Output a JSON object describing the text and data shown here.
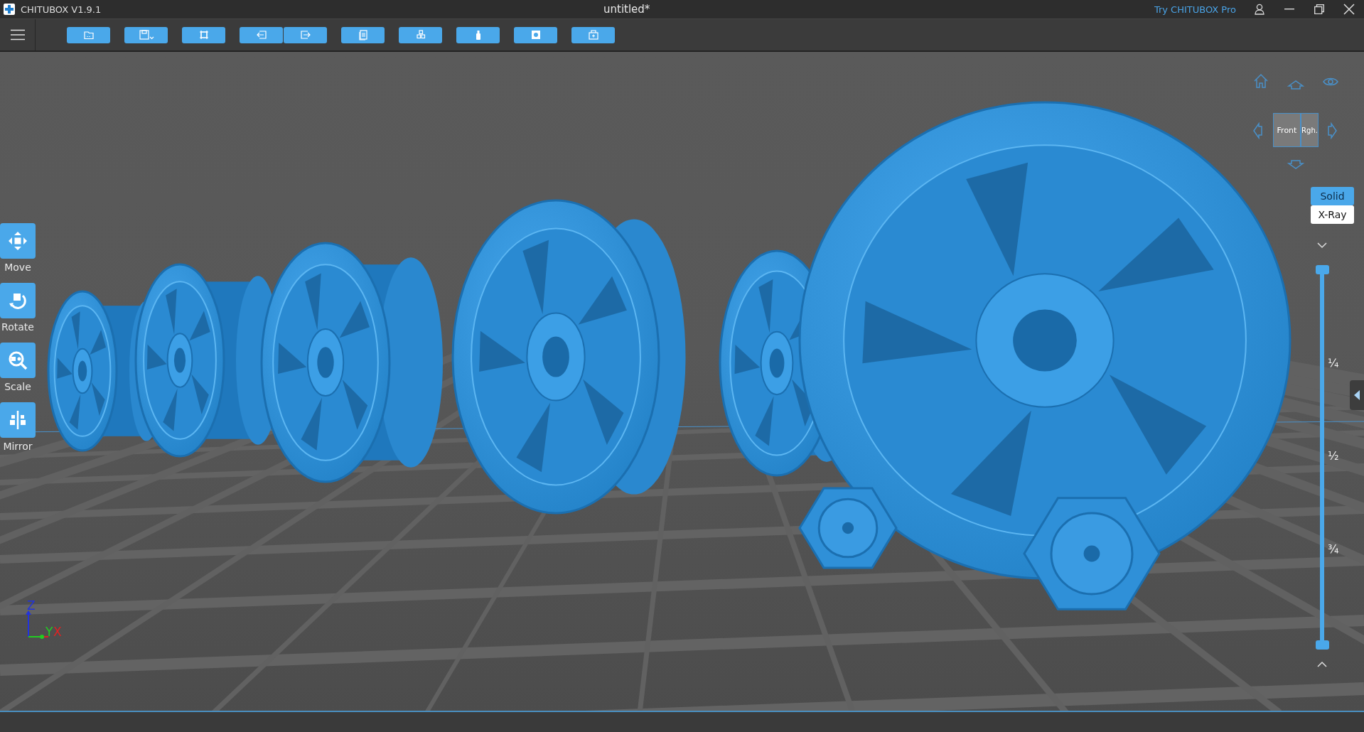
{
  "window": {
    "title": "CHITUBOX V1.9.1",
    "document": "untitled*",
    "pro_link": "Try CHITUBOX Pro"
  },
  "tools": [
    {
      "label": "Move",
      "kind": "move"
    },
    {
      "label": "Rotate",
      "kind": "rotate"
    },
    {
      "label": "Scale",
      "kind": "scale"
    },
    {
      "label": "Mirror",
      "kind": "mirror"
    }
  ],
  "view_cube": {
    "front": "Front",
    "right": "Rgh."
  },
  "render_modes": [
    {
      "label": "Solid",
      "selected": true
    },
    {
      "label": "X-Ray",
      "selected": false
    }
  ],
  "layer_slider": {
    "level": 1,
    "ticks": [
      "¼",
      "½",
      "¾"
    ]
  },
  "axes": {
    "z": "Z",
    "y": "Y",
    "x": "X"
  }
}
